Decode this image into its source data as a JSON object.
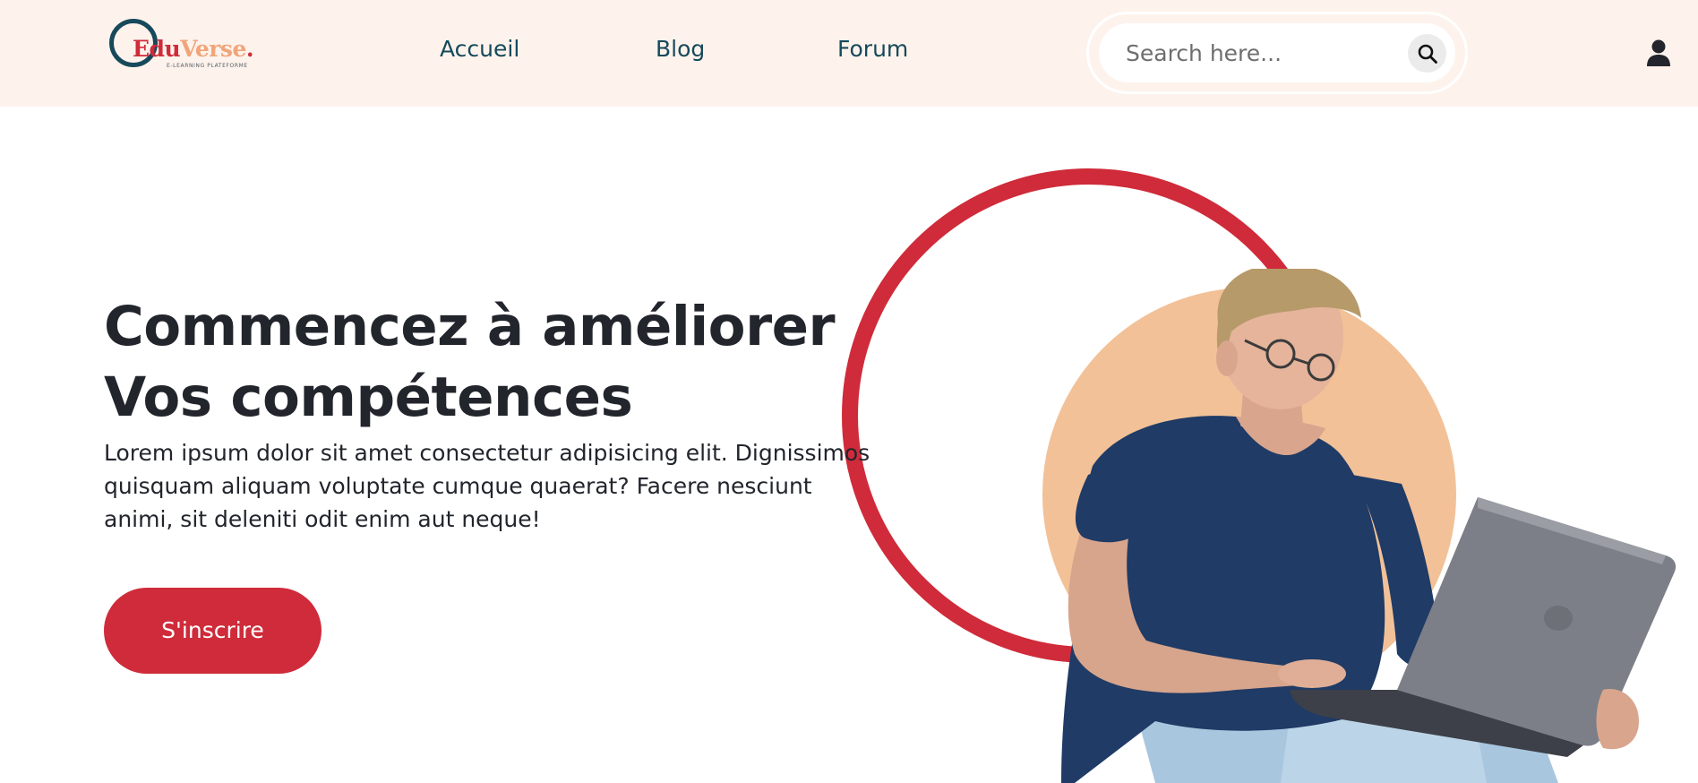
{
  "header": {
    "logo": {
      "part1": "Edu",
      "part2": "Verse",
      "dot": ".",
      "tagline": "E-LEARNING PLATEFORME"
    },
    "nav": [
      {
        "label": "Accueil"
      },
      {
        "label": "Blog"
      },
      {
        "label": "Forum"
      }
    ],
    "search": {
      "placeholder": "Search here...",
      "value": ""
    }
  },
  "hero": {
    "title_line1": "Commencez à améliorer",
    "title_line2": "Vos compétences",
    "text_lines": [
      "Lorem ipsum dolor sit amet consectetur adipisicing elit. Dignissimos",
      "quisquam aliquam voluptate cumque quaerat? Facere nesciunt",
      "animi, sit deleniti odit enim aut neque!"
    ],
    "cta_label": "S'inscrire"
  },
  "icons": {
    "search": "search-icon",
    "user": "user-icon"
  },
  "colors": {
    "header_bg": "#fdf3ec",
    "accent_red": "#cf2b3a",
    "peach": "#f2c197",
    "nav_text": "#16495b",
    "heading": "#22252c"
  }
}
